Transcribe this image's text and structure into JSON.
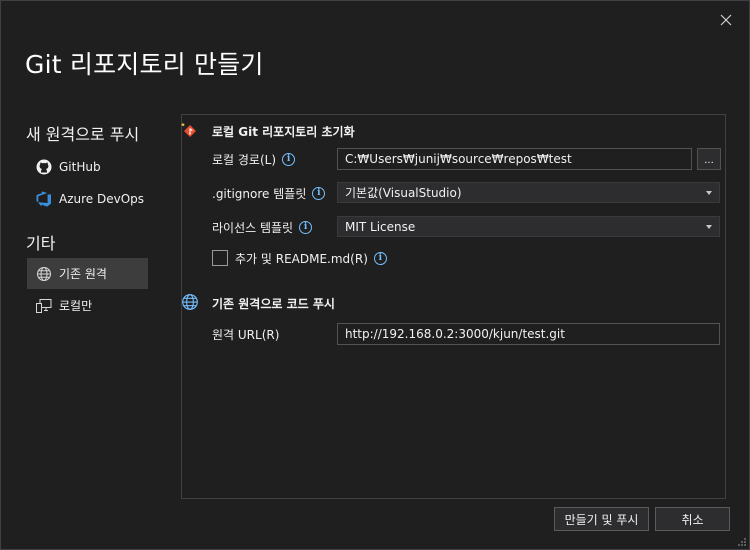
{
  "dialog": {
    "title": "Git 리포지토리 만들기"
  },
  "sidebar": {
    "push_heading": "새 원격으로 푸시",
    "push_items": [
      {
        "label": "GitHub",
        "icon": "github-icon"
      },
      {
        "label": "Azure DevOps",
        "icon": "azure-devops-icon"
      }
    ],
    "other_heading": "기타",
    "other_items": [
      {
        "label": "기존 원격",
        "icon": "globe-icon",
        "selected": true
      },
      {
        "label": "로컬만",
        "icon": "local-computer-icon",
        "selected": false
      }
    ]
  },
  "local_repo": {
    "heading": "로컬 Git 리포지토리 초기화",
    "path_label": "로컬 경로(L)",
    "path_value": "C:₩Users₩junij₩source₩repos₩test",
    "browse_label": "...",
    "gitignore_label": ".gitignore 템플릿",
    "gitignore_value": "기본값(VisualStudio)",
    "license_label": "라이선스 템플릿",
    "license_value": "MIT License",
    "readme_label": "추가 및 README.md(R)",
    "readme_checked": false
  },
  "remote": {
    "heading": "기존 원격으로 코드 푸시",
    "url_label": "원격 URL(R)",
    "url_value": "http://192.168.0.2:3000/kjun/test.git"
  },
  "footer": {
    "create_push_label": "만들기 및 푸시",
    "cancel_label": "취소"
  },
  "colors": {
    "background": "#1f1f1f",
    "accent_blue": "#75beff",
    "git_red": "#e84e2f",
    "selected_bg": "#3d3d3d"
  }
}
